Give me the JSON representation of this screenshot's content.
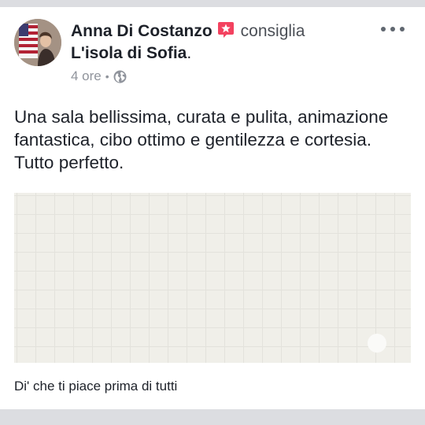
{
  "post": {
    "author": "Anna Di Costanzo",
    "action": "consiglia",
    "page": "L'isola di Sofia",
    "page_suffix": ".",
    "time": "4 ore",
    "separator": "•",
    "privacy_icon": "globe-icon",
    "recommend_icon": "recommendation-star-icon",
    "more_icon": "more-options-icon",
    "text": "Una sala bellissima, curata e pulita, animazione fantastica, cibo ottimo e gentilezza e cortesia. Tutto perfetto.",
    "like_prompt": "Di' che ti piace prima di tutti"
  },
  "colors": {
    "text": "#1d2129",
    "meta": "#90949c",
    "recommend": "#f3425f",
    "divider": "#dcdde1",
    "map_background": "#f0efe9"
  }
}
